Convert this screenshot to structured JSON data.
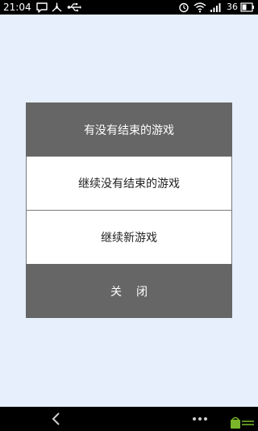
{
  "status_bar": {
    "time": "21:04",
    "battery": "36",
    "icons": [
      "chat-icon",
      "share-icon",
      "usb-icon",
      "alarm-icon",
      "wifi-icon",
      "signal-icon",
      "battery-icon"
    ]
  },
  "dialog": {
    "title": "有没有结束的游戏",
    "options": [
      "继续没有结束的游戏",
      "继续新游戏"
    ],
    "close_label": "关闭"
  },
  "nav_bar": {
    "icons": [
      "back-icon",
      "menu-dots-icon",
      "app-watermark-icon"
    ]
  },
  "colors": {
    "background": "#e6effb",
    "dialog_header": "#666666",
    "dialog_option": "#ffffff"
  }
}
